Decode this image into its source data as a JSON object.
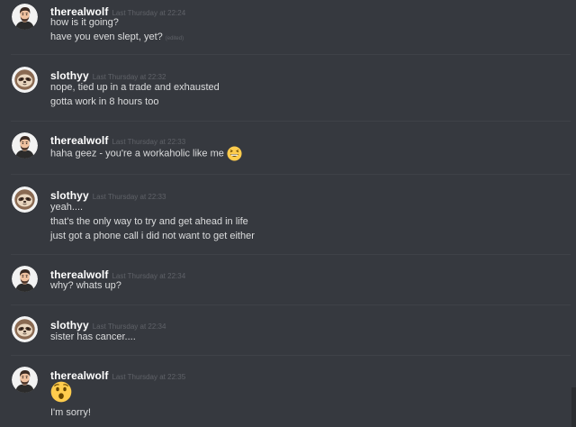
{
  "users": {
    "wolf": {
      "name": "therealwolf",
      "avatar_icon": "person-avatar-icon"
    },
    "sloth": {
      "name": "slothyy",
      "avatar_icon": "sloth-avatar-icon"
    }
  },
  "colors": {
    "background": "#36393f",
    "username": "#ffffff",
    "text": "#dcddde",
    "timestamp": "#5f6268",
    "divider": "#3f4248"
  },
  "messages": [
    {
      "author": "therealwolf",
      "timestamp": "Last Thursday at 22:24",
      "lines": [
        "how is it going?",
        "have you even slept, yet?"
      ],
      "edited_label": "(edited)"
    },
    {
      "author": "slothyy",
      "timestamp": "Last Thursday at 22:32",
      "lines": [
        "nope, tied up in a trade and exhausted",
        "gotta work in 8 hours too"
      ]
    },
    {
      "author": "therealwolf",
      "timestamp": "Last Thursday at 22:33",
      "lines": [
        "haha geez - you're a workaholic like me"
      ],
      "emoji": "grinning-squint-emoji"
    },
    {
      "author": "slothyy",
      "timestamp": "Last Thursday at 22:33",
      "lines": [
        "yeah....",
        "that's the only way to try and get ahead in life",
        "just got a phone call i did not want to get either"
      ]
    },
    {
      "author": "therealwolf",
      "timestamp": "Last Thursday at 22:34",
      "lines": [
        "why? whats up?"
      ]
    },
    {
      "author": "slothyy",
      "timestamp": "Last Thursday at 22:34",
      "lines": [
        "sister has cancer...."
      ]
    },
    {
      "author": "therealwolf",
      "timestamp": "Last Thursday at 22:35",
      "emoji": "astonished-face-emoji",
      "lines": [
        "I'm sorry!"
      ]
    }
  ]
}
